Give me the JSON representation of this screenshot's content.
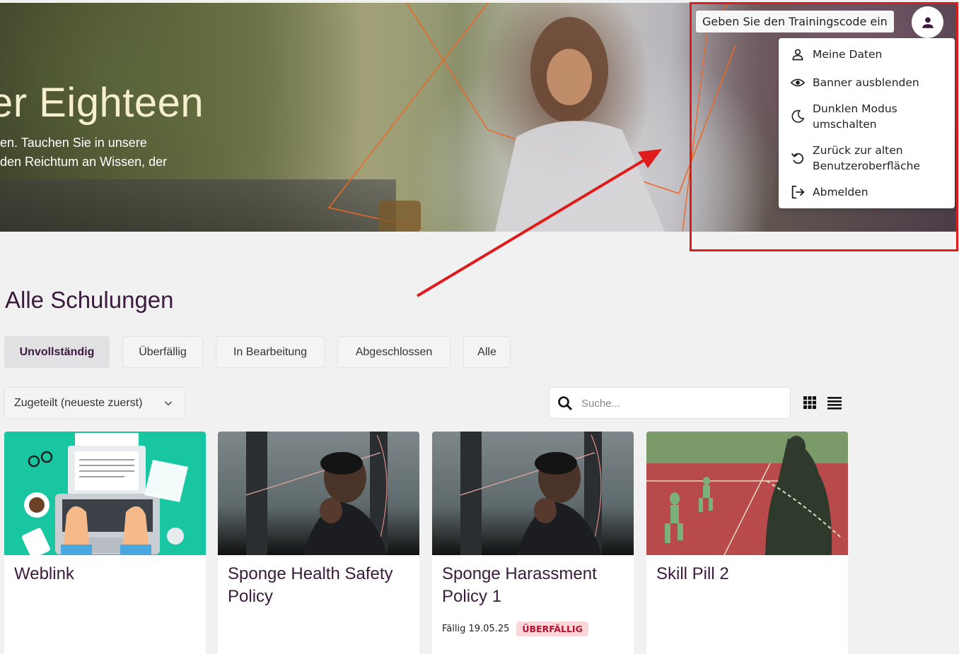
{
  "hero": {
    "title": "er Eighteen",
    "subtitle_line1": "en. Tauchen Sie in unsere",
    "subtitle_line2": "den Reichtum an Wissen, der"
  },
  "header": {
    "training_code_label": "Geben Sie den Trainingscode ein",
    "avatar_icon": "person-icon"
  },
  "user_menu": {
    "items": [
      {
        "label": "Meine Daten",
        "icon": "person-outline-icon"
      },
      {
        "label": "Banner ausblenden",
        "icon": "eye-icon"
      },
      {
        "label_line1": "Dunklen Modus",
        "label_line2": "umschalten",
        "icon": "moon-icon"
      },
      {
        "label_line1": "Zurück zur alten",
        "label_line2": "Benutzeroberfläche",
        "icon": "undo-icon"
      },
      {
        "label": "Abmelden",
        "icon": "logout-icon"
      }
    ]
  },
  "main": {
    "title": "Alle Schulungen",
    "filters": [
      {
        "label": "Unvollständig",
        "active": true
      },
      {
        "label": "Überfällig",
        "active": false
      },
      {
        "label": "In Bearbeitung",
        "active": false
      },
      {
        "label": "Abgeschlossen",
        "active": false
      },
      {
        "label": "Alle",
        "active": false
      }
    ],
    "sort": {
      "selected": "Zugeteilt (neueste zuerst)"
    },
    "search": {
      "placeholder": "Suche...",
      "value": ""
    },
    "view_toggle": [
      "grid-view-icon",
      "list-view-icon"
    ]
  },
  "cards": [
    {
      "title": "Weblink"
    },
    {
      "title": "Sponge Health Safety Policy"
    },
    {
      "title": "Sponge Harassment Policy 1",
      "due": "Fällig 19.05.25",
      "badge": "ÜBERFÄLLIG"
    },
    {
      "title": "Skill Pill 2"
    }
  ],
  "colors": {
    "brand_purple": "#3b1a3e",
    "annotation_red": "#e01b1b",
    "overdue_bg": "#fbd7dc",
    "overdue_text": "#b3122e"
  }
}
